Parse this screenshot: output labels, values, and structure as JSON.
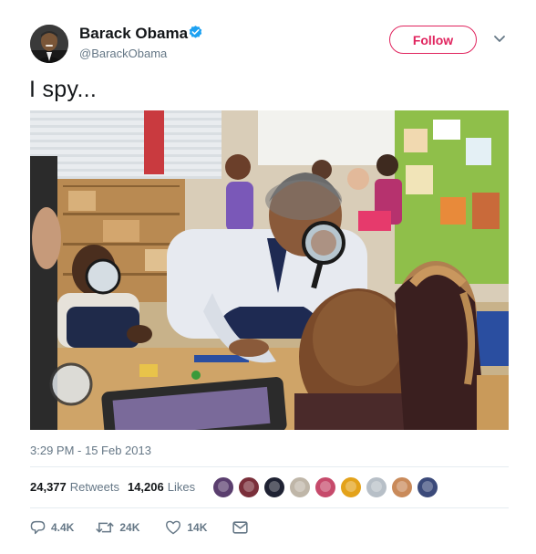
{
  "author": {
    "display_name": "Barack Obama",
    "handle": "@BarackObama",
    "verified": true,
    "avatar_icon": "profile-photo"
  },
  "follow_label": "Follow",
  "more_icon": "chevron-down-icon",
  "tweet_text": "I spy...",
  "media": {
    "icon": "photo-classroom-magnifying-glass"
  },
  "timestamp": "3:29 PM - 15 Feb 2013",
  "stats": {
    "retweets_count": "24,377",
    "retweets_label": "Retweets",
    "likes_count": "14,206",
    "likes_label": "Likes"
  },
  "liker_avatars": [
    "#5a3e6e",
    "#7a2f3a",
    "#1f2233",
    "#bfb6a8",
    "#c64a6b",
    "#e3a21a",
    "#b7bfc7",
    "#c98a5a",
    "#3b4a7a"
  ],
  "actions": {
    "reply_count": "4.4K",
    "retweet_count": "24K",
    "like_count": "14K"
  },
  "colors": {
    "accent": "#e0245e",
    "verified": "#1da1f2",
    "muted": "#657786"
  }
}
